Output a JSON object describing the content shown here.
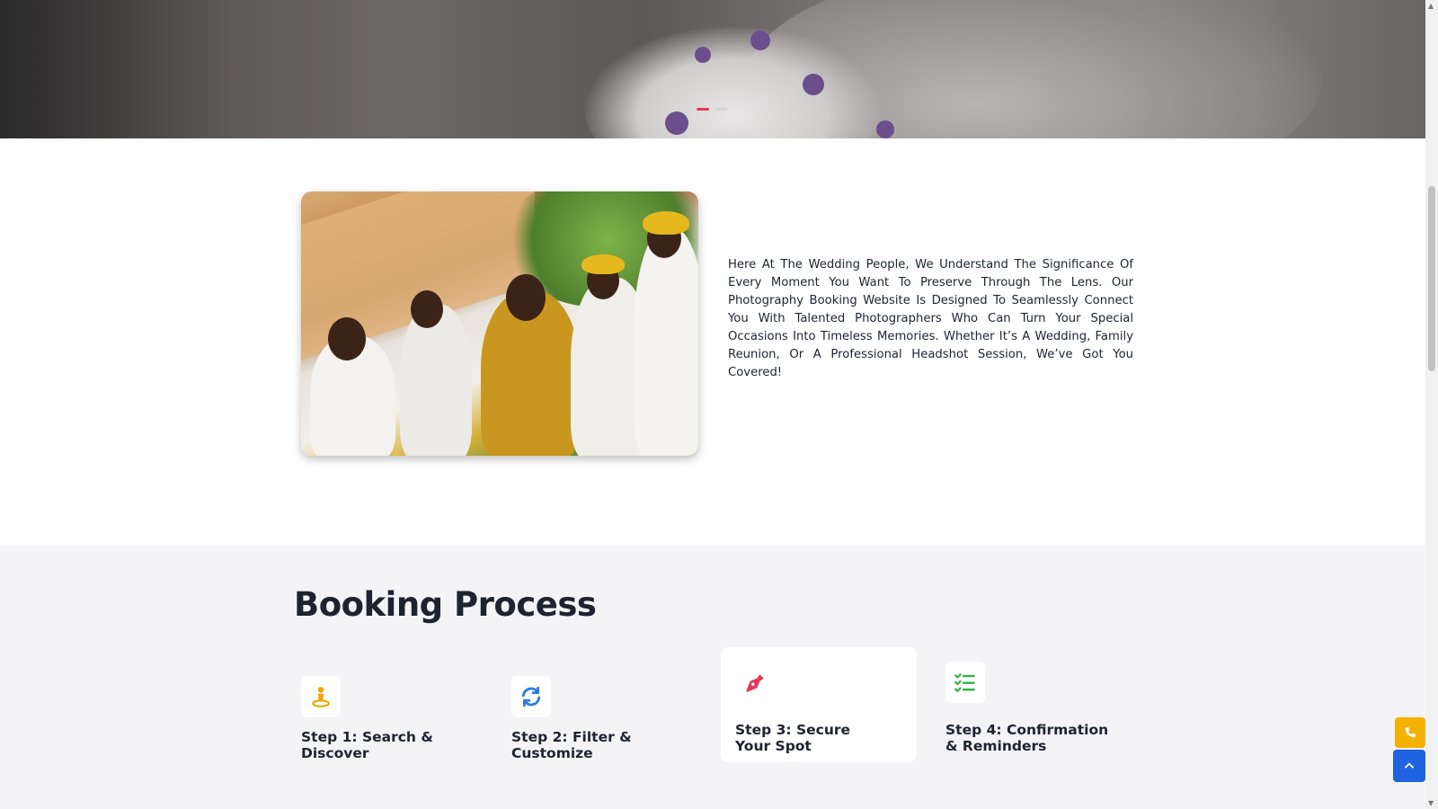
{
  "hero": {
    "slides": [
      {
        "active": true,
        "color": "#e6375a"
      },
      {
        "active": false,
        "color": "#d9d6d6"
      }
    ]
  },
  "intro": {
    "photo_alt": "wedding-guests-photo",
    "paragraph": "Here At The Wedding People, We Understand The Significance Of Every Moment You Want To Preserve Through The Lens. Our Photography Booking Website Is Designed To Seamlessly Connect You With Talented Photographers Who Can Turn Your Special Occasions Into Timeless Memories. Whether It’s A Wedding, Family Reunion, Or A Professional Headshot Session, We’ve Got You Covered!"
  },
  "booking": {
    "title": "Booking Process",
    "steps": [
      {
        "label": "Step 1: Search & Discover",
        "icon": "search-person-icon",
        "icon_color": "#f0a500"
      },
      {
        "label": "Step 2: Filter & Customize",
        "icon": "refresh-icon",
        "icon_color": "#2a7be4"
      },
      {
        "label": "Step 3: Secure Your Spot",
        "icon": "pen-nib-icon",
        "icon_color": "#e6375a"
      },
      {
        "label": "Step 4: Confirmation & Reminders",
        "icon": "checklist-icon",
        "icon_color": "#2fb344"
      }
    ]
  },
  "floating": {
    "call_icon": "phone-icon",
    "call_color": "#f5b100",
    "top_icon": "chevron-up-icon",
    "top_color": "#1f63e0"
  }
}
